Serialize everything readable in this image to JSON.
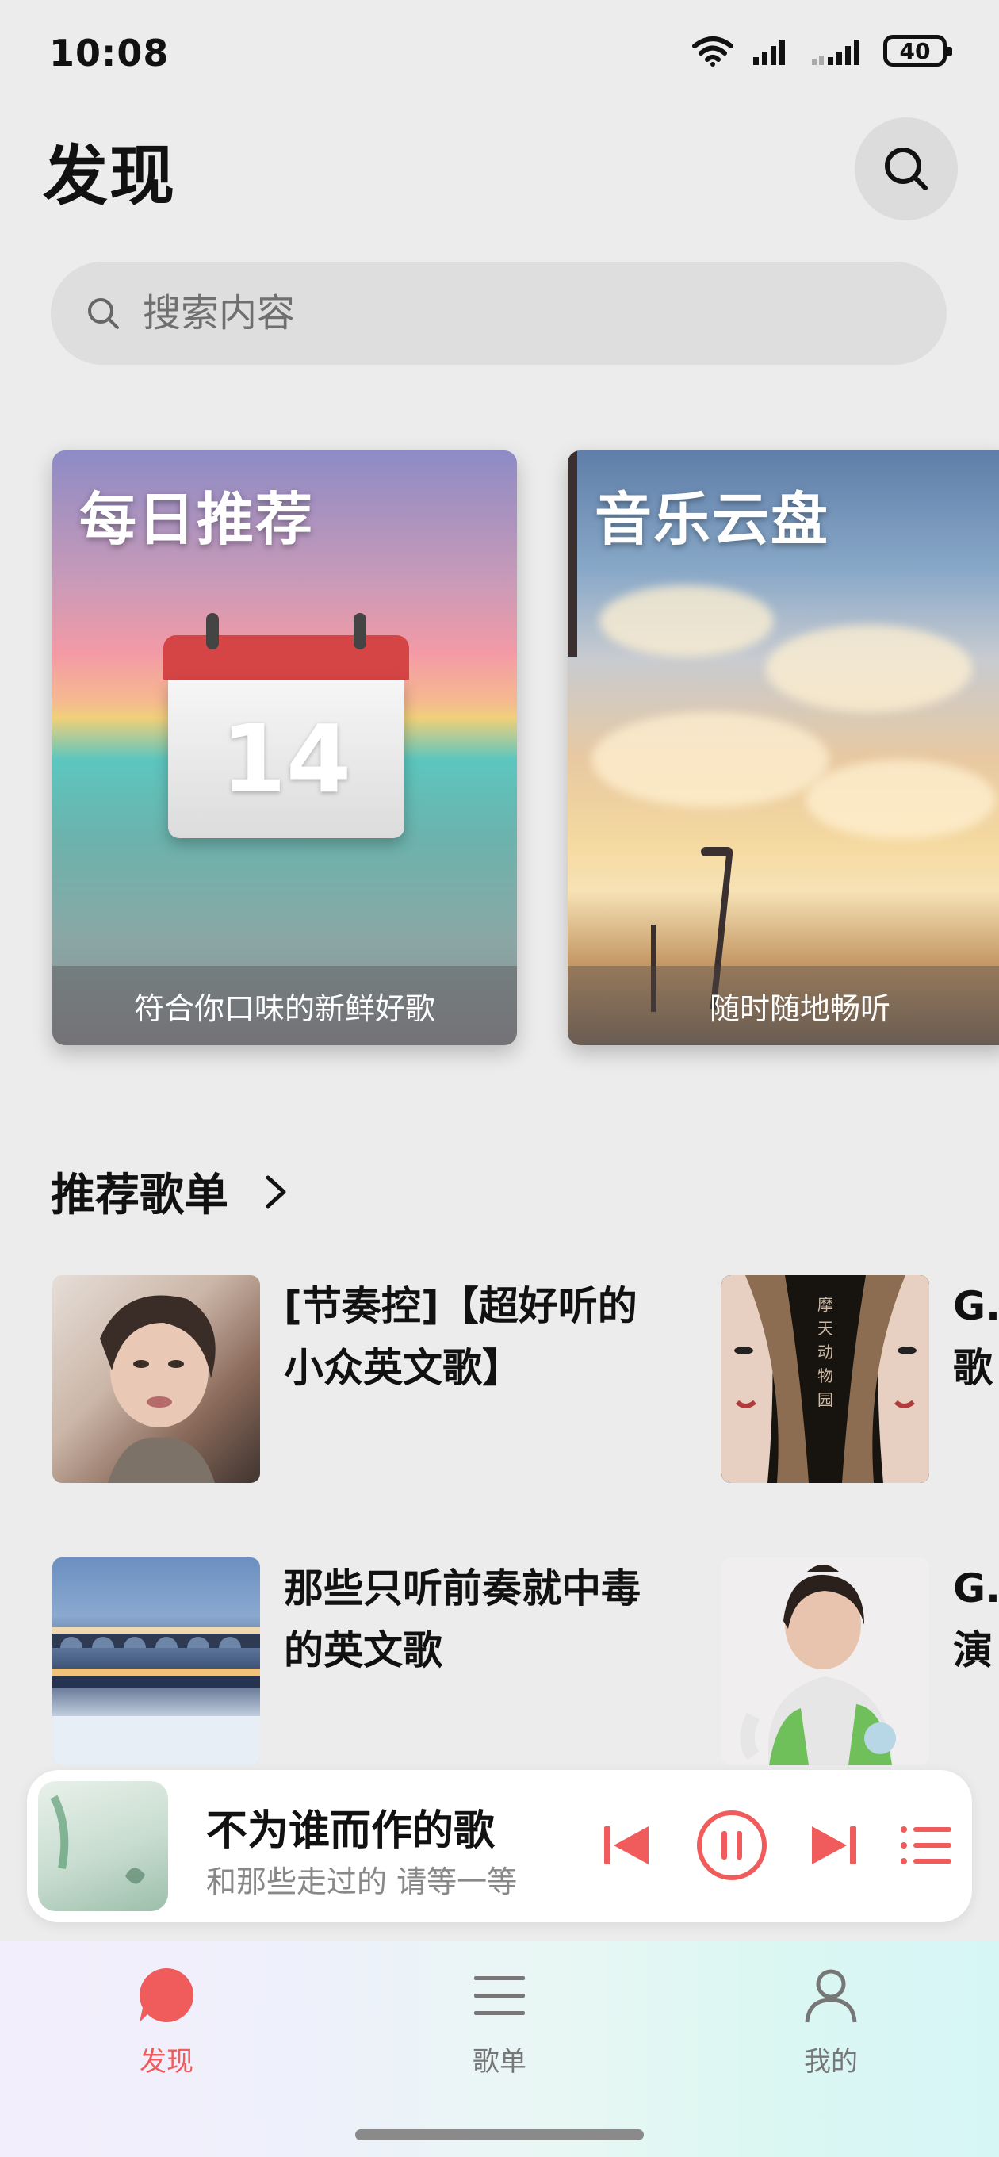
{
  "status_bar": {
    "time": "10:08",
    "battery": "40"
  },
  "header": {
    "title": "发现"
  },
  "search": {
    "placeholder": "搜索内容"
  },
  "cards": [
    {
      "title": "每日推荐",
      "caption": "符合你口味的新鲜好歌",
      "calendar_day": "14"
    },
    {
      "title": "音乐云盘",
      "caption": "随时随地畅听"
    }
  ],
  "recommended": {
    "title": "推荐歌单",
    "playlists": [
      {
        "name": "[节奏控]【超好听的小众英文歌】"
      },
      {
        "name": "G.歌"
      },
      {
        "name": "那些只听前奏就中毒的英文歌"
      },
      {
        "name": "G.GL演"
      }
    ],
    "cover_text": "摩天动物园"
  },
  "player": {
    "title": "不为谁而作的歌",
    "subtitle": "和那些走过的 请等一等"
  },
  "tabs": [
    {
      "label": "发现",
      "icon": "discover-icon",
      "active": true
    },
    {
      "label": "歌单",
      "icon": "list-icon",
      "active": false
    },
    {
      "label": "我的",
      "icon": "person-icon",
      "active": false
    }
  ],
  "colors": {
    "accent": "#f05c5c",
    "background": "#ececec"
  }
}
